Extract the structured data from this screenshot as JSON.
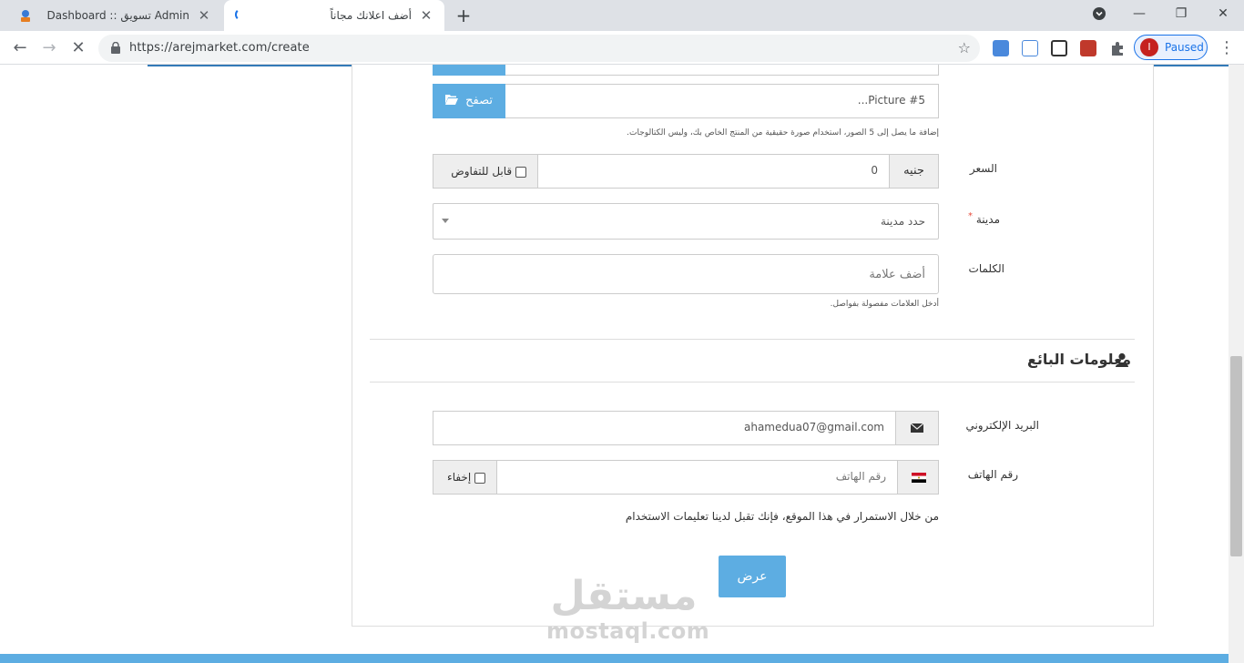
{
  "browser": {
    "tabs": [
      {
        "title": "Dashboard :: تسويق Admin",
        "active": false
      },
      {
        "title": "أضف اعلانك مجاناً",
        "active": true,
        "loading": true
      }
    ],
    "url": "https://arejmarket.com/create",
    "profile_status": "Paused",
    "profile_initial": "I"
  },
  "form": {
    "picture_placeholder": "Picture #5...",
    "browse_label": "تصفح",
    "pictures_help": "إضافة ما يصل إلى 5 الصور، استخدام صورة حقيقية من المنتج الخاص بك، وليس الكتالوجات.",
    "price_label": "السعر",
    "price_currency": "جنيه",
    "price_value": "0",
    "negotiable_label": "قابل للتفاوض",
    "city_label": "مدينة",
    "city_required_mark": "*",
    "city_placeholder": "حدد مدينة",
    "tags_label": "الكلمات",
    "tags_placeholder": "أضف علامة",
    "tags_help": "أدخل العلامات مفصولة بفواصل."
  },
  "seller": {
    "section_title": "معلومات البائع",
    "email_label": "البريد الإلكتروني",
    "email_value": "ahamedua07@gmail.com",
    "phone_label": "رقم الهاتف",
    "phone_placeholder": "رقم الهاتف",
    "hide_label": "إخفاء"
  },
  "terms_text": "من خلال الاستمرار في هذا الموقع، فإنك تقبل لدينا تعليمات الاستخدام",
  "submit_label": "عرض",
  "watermark": {
    "arabic": "مستقل",
    "latin": "mostaql.com"
  },
  "colors": {
    "accent": "#5dade2",
    "link": "#337ab7"
  }
}
